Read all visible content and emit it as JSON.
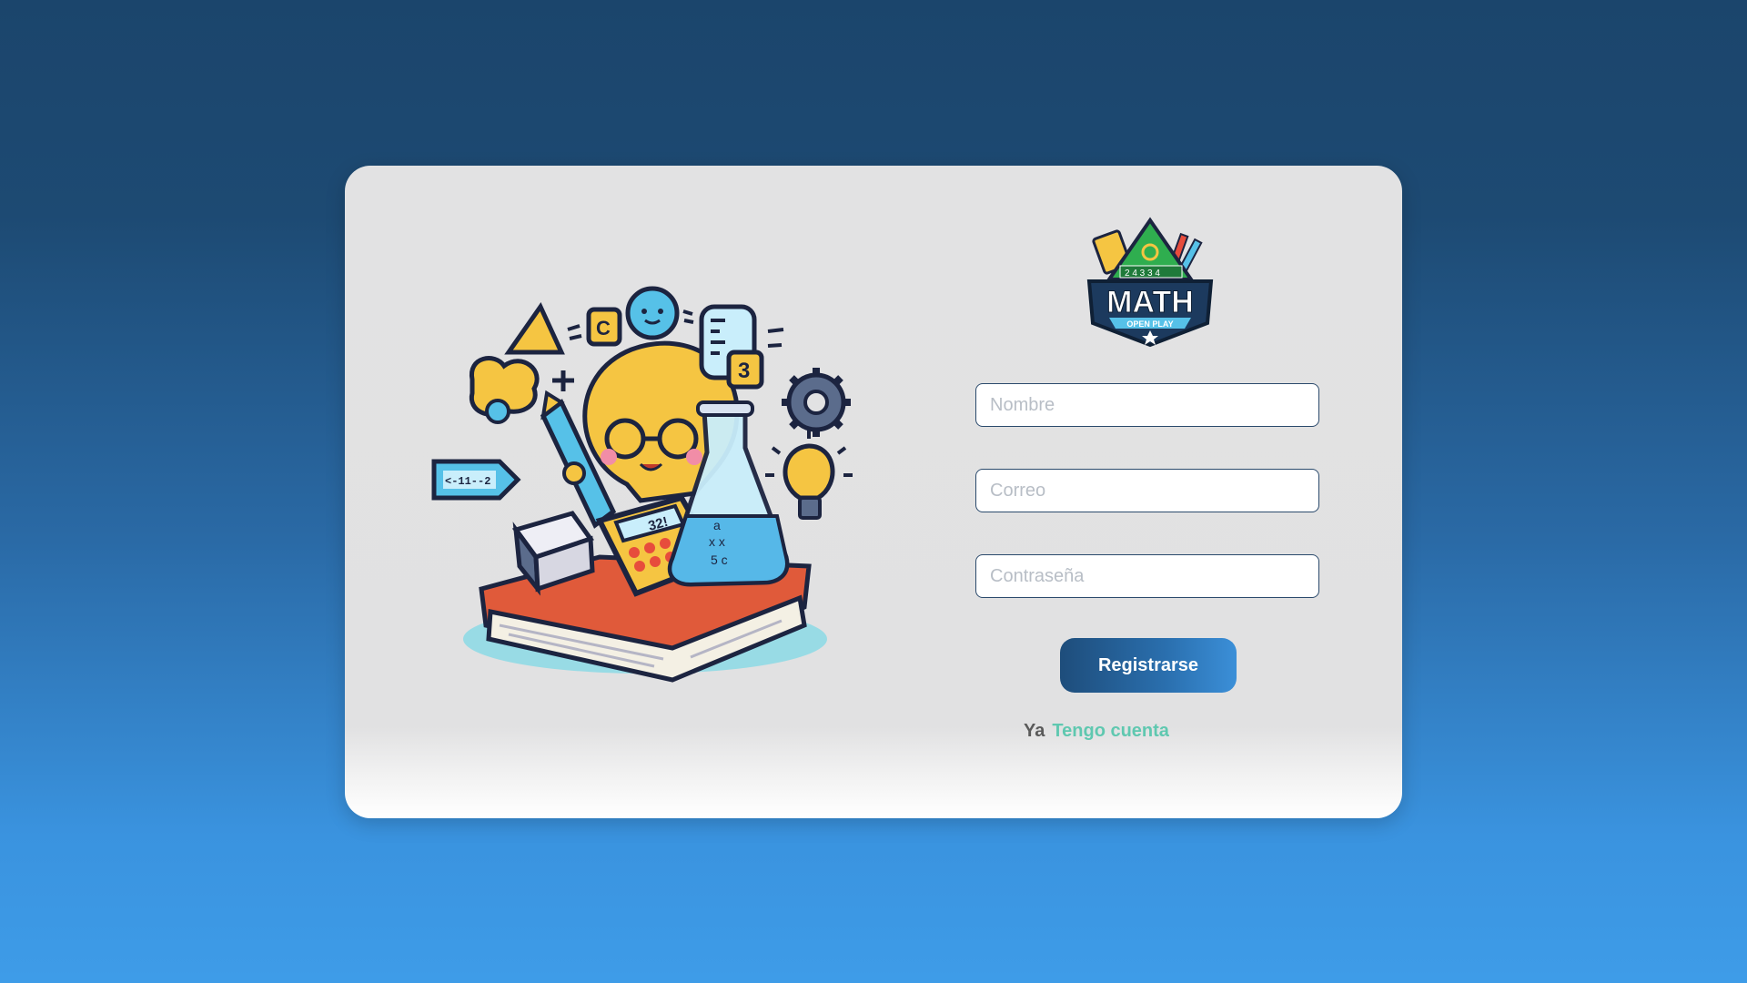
{
  "logo": {
    "title": "MATH",
    "subtitle": "OPEN PLAY",
    "badge_digits": "2 4 3 3 4"
  },
  "illustration": {
    "calculator_display": "32!",
    "tag_text": "<-11--2",
    "flask_text": "a\nx x\n5 c",
    "note_digit": "3",
    "block_letter": "C"
  },
  "form": {
    "name_placeholder": "Nombre",
    "email_placeholder": "Correo",
    "password_placeholder": "Contraseña",
    "submit_label": "Registrarse"
  },
  "footer": {
    "prefix": "Ya",
    "link_label": "Tengo cuenta"
  },
  "colors": {
    "accent": "#2a6fae",
    "link": "#5fc8b0",
    "field_border": "#2b4a6c"
  }
}
